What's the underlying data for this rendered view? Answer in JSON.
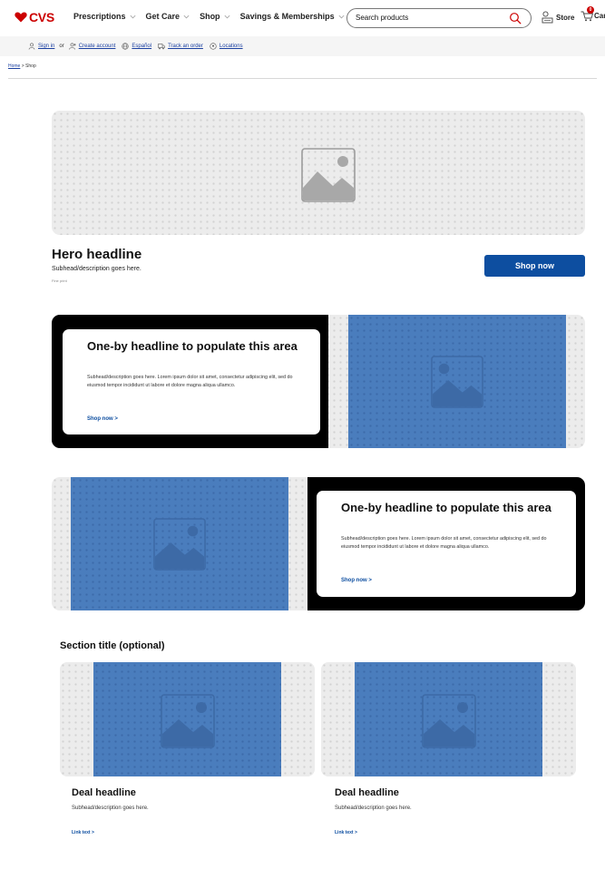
{
  "header": {
    "logo_text": "CVS",
    "brand_color": "#cc0000",
    "nav": [
      {
        "label": "Prescriptions"
      },
      {
        "label": "Get Care"
      },
      {
        "label": "Shop"
      },
      {
        "label": "Savings & Memberships"
      }
    ],
    "search": {
      "value": "Search products",
      "icon": "search-icon"
    },
    "store_label": "Store",
    "cart_label": "Cart",
    "cart_count": "0"
  },
  "utility": {
    "sign_in": "Sign in",
    "or": "or",
    "create_account": "Create account",
    "espanol": "Español",
    "track_order": "Track an order",
    "locations": "Locations"
  },
  "breadcrumb": {
    "home": "Home",
    "separator": ">",
    "current": "Shop"
  },
  "hero": {
    "headline": "Hero headline",
    "subhead": "Subhead/description goes here.",
    "fine_print": "Fine print",
    "cta": "Shop now",
    "cta_color": "#0d4ea0"
  },
  "oneby": [
    {
      "headline": "One-by headline to populate this area",
      "body": "Subhead/description goes here. Lorem ipsum dolor sit amet, consectetur adipiscing elit, sed do eiusmod tempor incididunt ut labore et dolore magna aliqua ullamco.",
      "link": "Shop now >"
    },
    {
      "headline": "One-by headline to populate this area",
      "body": "Subhead/description goes here. Lorem ipsum dolor sit amet, consectetur adipiscing elit, sed do eiusmod tempor incididunt ut labore et dolore magna aliqua ullamco.",
      "link": "Shop now >"
    }
  ],
  "section": {
    "title": "Section title (optional)",
    "deals": [
      {
        "headline": "Deal headline",
        "subhead": "Subhead/description goes here.",
        "link": "Link text >"
      },
      {
        "headline": "Deal headline",
        "subhead": "Subhead/description goes here.",
        "link": "Link text >"
      }
    ]
  }
}
